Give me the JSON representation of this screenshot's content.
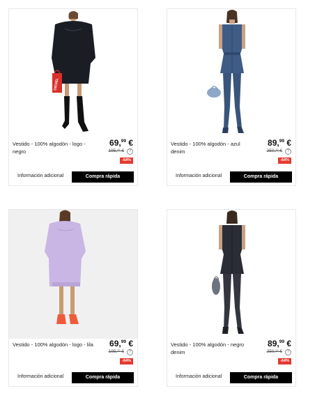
{
  "products": [
    {
      "title": "Vestido - 100% algodón - logo - negro",
      "price_main": "69,",
      "price_cents": "99",
      "currency": "€",
      "old_price": "195,²² €",
      "discount": "-64%",
      "more_info": "Información adicional",
      "quick_buy": "Compra rápida"
    },
    {
      "title": "Vestido - 100% algodón - azul denim",
      "price_main": "89,",
      "price_cents": "99",
      "currency": "€",
      "old_price": "250,²² €",
      "discount": "-64%",
      "more_info": "Información adicional",
      "quick_buy": "Compra rápida"
    },
    {
      "title": "Vestido - 100% algodón - logo - lila",
      "price_main": "69,",
      "price_cents": "99",
      "currency": "€",
      "old_price": "195,²² €",
      "discount": "-64%",
      "more_info": "Información adicional",
      "quick_buy": "Compra rápida"
    },
    {
      "title": "Vestido - 100% algodón - negro denim",
      "price_main": "89,",
      "price_cents": "99",
      "currency": "€",
      "old_price": "250,²² €",
      "discount": "-64%",
      "more_info": "Información adicional",
      "quick_buy": "Compra rápida"
    }
  ],
  "bag_logo_text": "DIESEL",
  "info_icon_glyph": "?"
}
